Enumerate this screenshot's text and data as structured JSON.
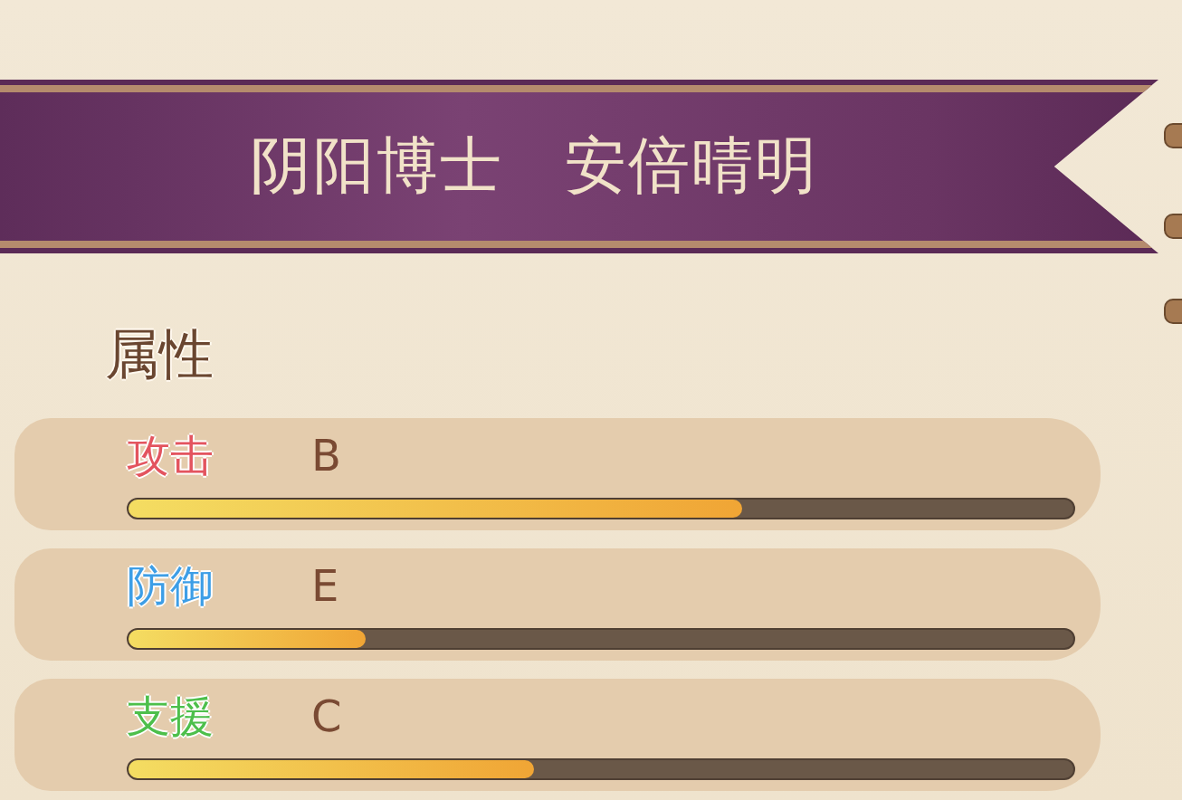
{
  "banner": {
    "title": "阴阳博士",
    "name": "安倍晴明"
  },
  "section": {
    "heading": "属性"
  },
  "stats": [
    {
      "label": "攻击",
      "color": "#e3545f",
      "grade": "B",
      "level": 0.65
    },
    {
      "label": "防御",
      "color": "#3d9ee6",
      "grade": "E",
      "level": 0.25
    },
    {
      "label": "支援",
      "color": "#4dbf4b",
      "grade": "C",
      "level": 0.43
    }
  ]
}
